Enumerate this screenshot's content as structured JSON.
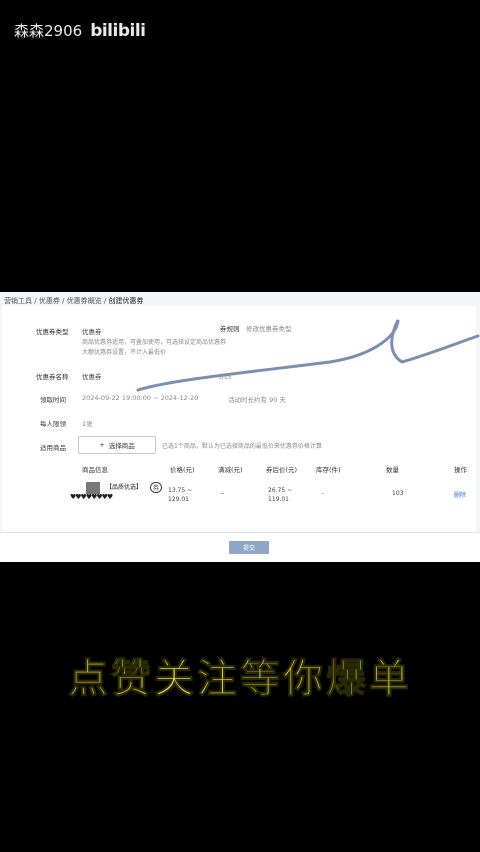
{
  "watermark": {
    "user": "森森2906",
    "brand": "bilibili"
  },
  "breadcrumb": {
    "items": [
      "营销工具",
      "优惠券",
      "优惠券概览"
    ],
    "current": "创建优惠券",
    "sep": "/"
  },
  "form": {
    "type_label": "优惠券类型",
    "type_value": "优惠券",
    "type_desc1": "商品优惠券适用，可叠加使用，可选择设定商品优惠券",
    "type_desc2": "大额优惠券设置，不计入最低价",
    "scope_label": "券规则",
    "scope_value": "修改优惠券类型",
    "name_label": "优惠券名称",
    "name_value": "优惠券",
    "name_count": "3/15",
    "time_label": "领取时间",
    "time_value": "2024-09-22 19:00:00  ~  2024-12-20",
    "time_note": "活动时长约有 90 天",
    "limit_label": "每人限领",
    "limit_value": "1张",
    "goods_label": "适用商品",
    "add_goods_button": "选择商品",
    "goods_hint": "已选1个商品，默认为已选择商品的最低价来优惠券价格计算"
  },
  "table": {
    "headers": [
      "商品信息",
      "价格(元)",
      "满减(元)",
      "券后价(元)",
      "库存(件)",
      "数量",
      "操作"
    ],
    "rows": [
      {
        "name": "【品质优选】",
        "badge": "券",
        "sub": "♥♥♥♥♥♥♥♥",
        "price": "13.75 ~ 129.01",
        "discount": "--",
        "after": "26.75 ~ 119.01",
        "stock": "-",
        "qty": "103",
        "action": "删除"
      }
    ]
  },
  "footer": {
    "submit_label": "提交"
  },
  "caption": "点赞关注等你爆单"
}
